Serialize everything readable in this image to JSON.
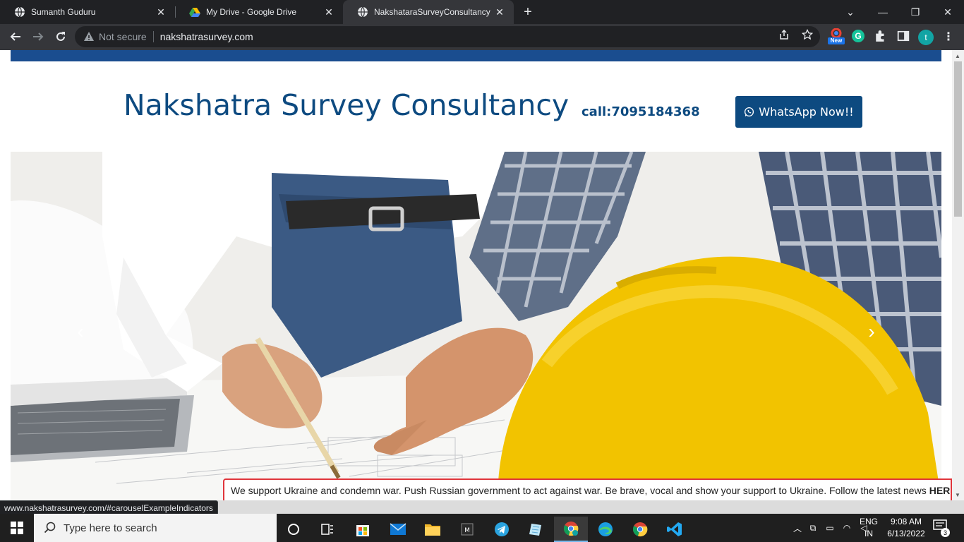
{
  "browser": {
    "tabs": [
      {
        "title": "Sumanth Guduru",
        "active": false
      },
      {
        "title": "My Drive - Google Drive",
        "active": false
      },
      {
        "title": "NakshataraSurveyConsultancy",
        "active": true
      }
    ],
    "new_tab_label": "+",
    "address": {
      "security_text": "Not secure",
      "url": "nakshatrasurvey.com"
    },
    "extension_badge": "New",
    "profile_initial": "t",
    "status_link": "www.nakshatrasurvey.com/#carouselExampleIndicators"
  },
  "page": {
    "brand_title": "Nakshatra Survey Consultancy",
    "call_text": "call:7095184368",
    "whatsapp_button": "WhatsApp Now!!",
    "ukraine_banner": {
      "text": "We support Ukraine and condemn war. Push Russian government to act against war. Be brave, vocal and show your support to Ukraine. Follow the latest news",
      "link": "HERE"
    },
    "colors": {
      "brand_blue": "#0d4a80",
      "top_bar": "#1a4d8f",
      "banner_border": "#e0353b"
    }
  },
  "taskbar": {
    "search_placeholder": "Type here to search",
    "language": "ENG",
    "region": "IN",
    "time": "9:08 AM",
    "date": "6/13/2022",
    "notification_count": "3",
    "pinned_icons": [
      "task-view-icon",
      "widgets-icon",
      "store-icon",
      "mail-icon",
      "file-explorer-icon",
      "app-icon",
      "telegram-icon",
      "notepad-icon",
      "chrome-icon",
      "edge-icon",
      "chrome-icon",
      "vscode-icon"
    ]
  }
}
